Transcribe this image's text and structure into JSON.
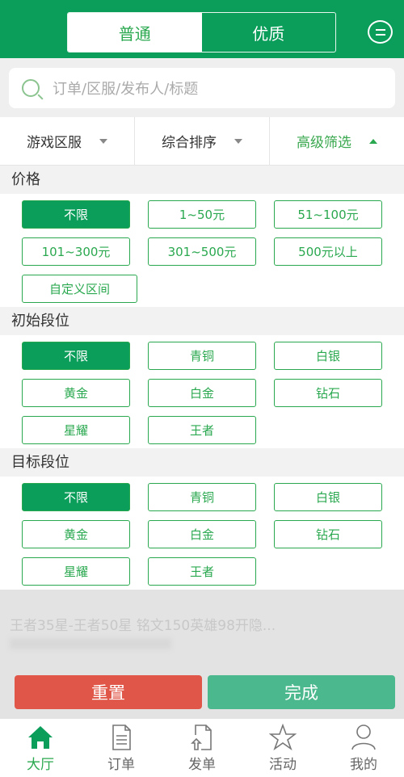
{
  "header": {
    "tabs": [
      {
        "label": "普通",
        "active": true
      },
      {
        "label": "优质",
        "active": false
      }
    ],
    "message_icon": "chat-menu-icon"
  },
  "search": {
    "placeholder": "订单/区服/发布人/标题",
    "icon": "search-icon"
  },
  "filters": [
    {
      "label": "游戏区服",
      "active": false
    },
    {
      "label": "综合排序",
      "active": false
    },
    {
      "label": "高级筛选",
      "active": true
    }
  ],
  "sections": {
    "price": {
      "title": "价格",
      "options": [
        "不限",
        "1~50元",
        "51~100元",
        "101~300元",
        "301~500元",
        "500元以上",
        "自定义区间"
      ],
      "selected": "不限"
    },
    "start_rank": {
      "title": "初始段位",
      "options": [
        "不限",
        "青铜",
        "白银",
        "黄金",
        "白金",
        "钻石",
        "星耀",
        "王者"
      ],
      "selected": "不限"
    },
    "target_rank": {
      "title": "目标段位",
      "options": [
        "不限",
        "青铜",
        "白银",
        "黄金",
        "白金",
        "钻石",
        "星耀",
        "王者"
      ],
      "selected": "不限"
    }
  },
  "background_item": {
    "title": "王者35星-王者50星 铭文150英雄98开隐..."
  },
  "actions": {
    "reset": "重置",
    "done": "完成",
    "reset_color": "#e0574a",
    "done_color": "#4bb88e"
  },
  "tabbar": [
    {
      "label": "大厅",
      "icon": "home-icon",
      "active": true
    },
    {
      "label": "订单",
      "icon": "document-icon"
    },
    {
      "label": "发单",
      "icon": "upload-document-icon"
    },
    {
      "label": "活动",
      "icon": "star-icon"
    },
    {
      "label": "我的",
      "icon": "user-icon"
    }
  ],
  "colors": {
    "brand": "#0a9e5a",
    "accent_text": "#2aa84f"
  }
}
